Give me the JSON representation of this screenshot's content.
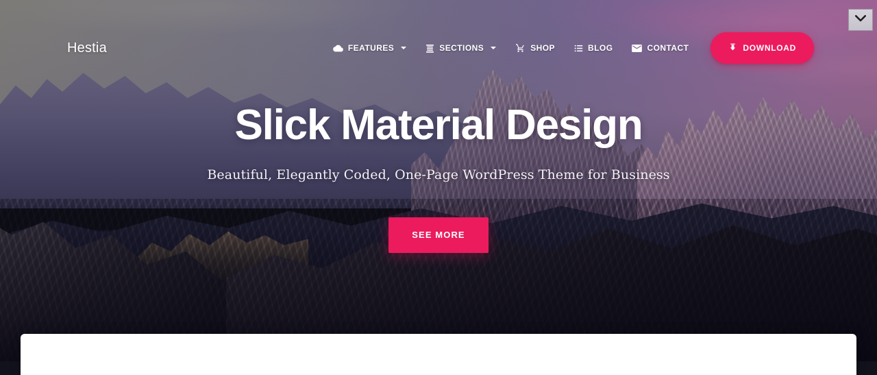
{
  "theme": {
    "accent_color": "#eb1b5e",
    "text_on_hero": "#ffffff"
  },
  "navbar": {
    "brand": "Hestia",
    "items": [
      {
        "label": "FEATURES",
        "icon": "cloud-icon",
        "has_caret": true
      },
      {
        "label": "SECTIONS",
        "icon": "sections-icon",
        "has_caret": true
      },
      {
        "label": "SHOP",
        "icon": "shopping-cart-icon",
        "has_caret": false
      },
      {
        "label": "BLOG",
        "icon": "list-icon",
        "has_caret": false
      },
      {
        "label": "CONTACT",
        "icon": "envelope-icon",
        "has_caret": false
      }
    ],
    "download_button": {
      "label": "DOWNLOAD",
      "icon": "download-icon"
    }
  },
  "hero": {
    "title": "Slick Material Design",
    "subtitle": "Beautiful, Elegantly Coded, One-Page WordPress Theme for Business",
    "cta_label": "SEE MORE"
  },
  "scroll_widget": {
    "icon": "chevron-down-icon"
  }
}
